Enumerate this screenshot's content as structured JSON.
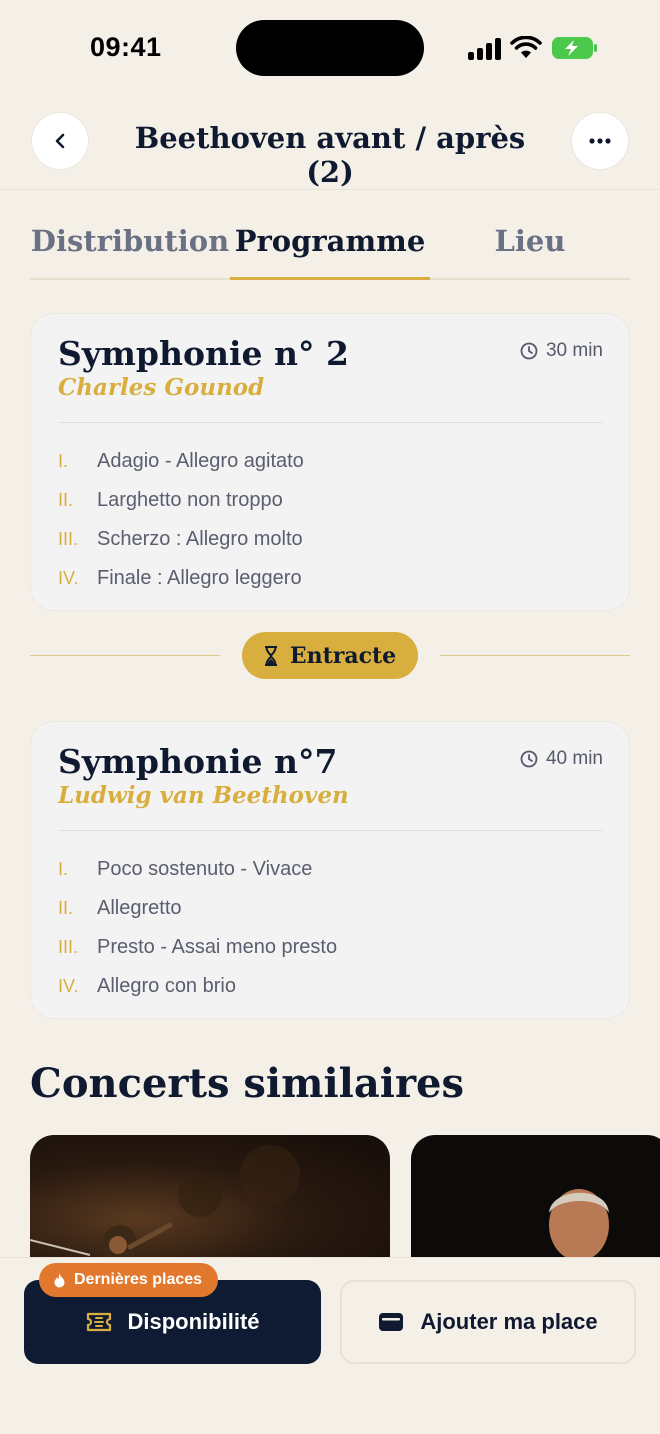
{
  "status_bar": {
    "time": "09:41"
  },
  "header": {
    "title": "Beethoven avant / après (2)"
  },
  "tabs": [
    {
      "label": "Distribution",
      "active": false
    },
    {
      "label": "Programme",
      "active": true
    },
    {
      "label": "Lieu",
      "active": false
    }
  ],
  "program": [
    {
      "title": "Symphonie n° 2",
      "composer": "Charles Gounod",
      "duration": "30 min",
      "movements": [
        {
          "num": "I.",
          "name": "Adagio - Allegro agitato"
        },
        {
          "num": "II.",
          "name": "Larghetto non troppo"
        },
        {
          "num": "III.",
          "name": "Scherzo : Allegro molto"
        },
        {
          "num": "IV.",
          "name": "Finale : Allegro leggero"
        }
      ]
    },
    {
      "title": "Symphonie n°7",
      "composer": "Ludwig van Beethoven",
      "duration": "40 min",
      "movements": [
        {
          "num": "I.",
          "name": "Poco sostenuto - Vivace"
        },
        {
          "num": "II.",
          "name": "Allegretto"
        },
        {
          "num": "III.",
          "name": "Presto - Assai meno presto"
        },
        {
          "num": "IV.",
          "name": "Allegro con brio"
        }
      ]
    }
  ],
  "intermission": {
    "label": "Entracte"
  },
  "similar": {
    "title": "Concerts similaires"
  },
  "bottom": {
    "badge": "Dernières places",
    "availability": "Disponibilité",
    "add_seat": "Ajouter ma place"
  },
  "colors": {
    "accent": "#d8ae3e",
    "navy": "#0f1b33",
    "badge": "#e2782d",
    "background": "#f4f0e8"
  }
}
